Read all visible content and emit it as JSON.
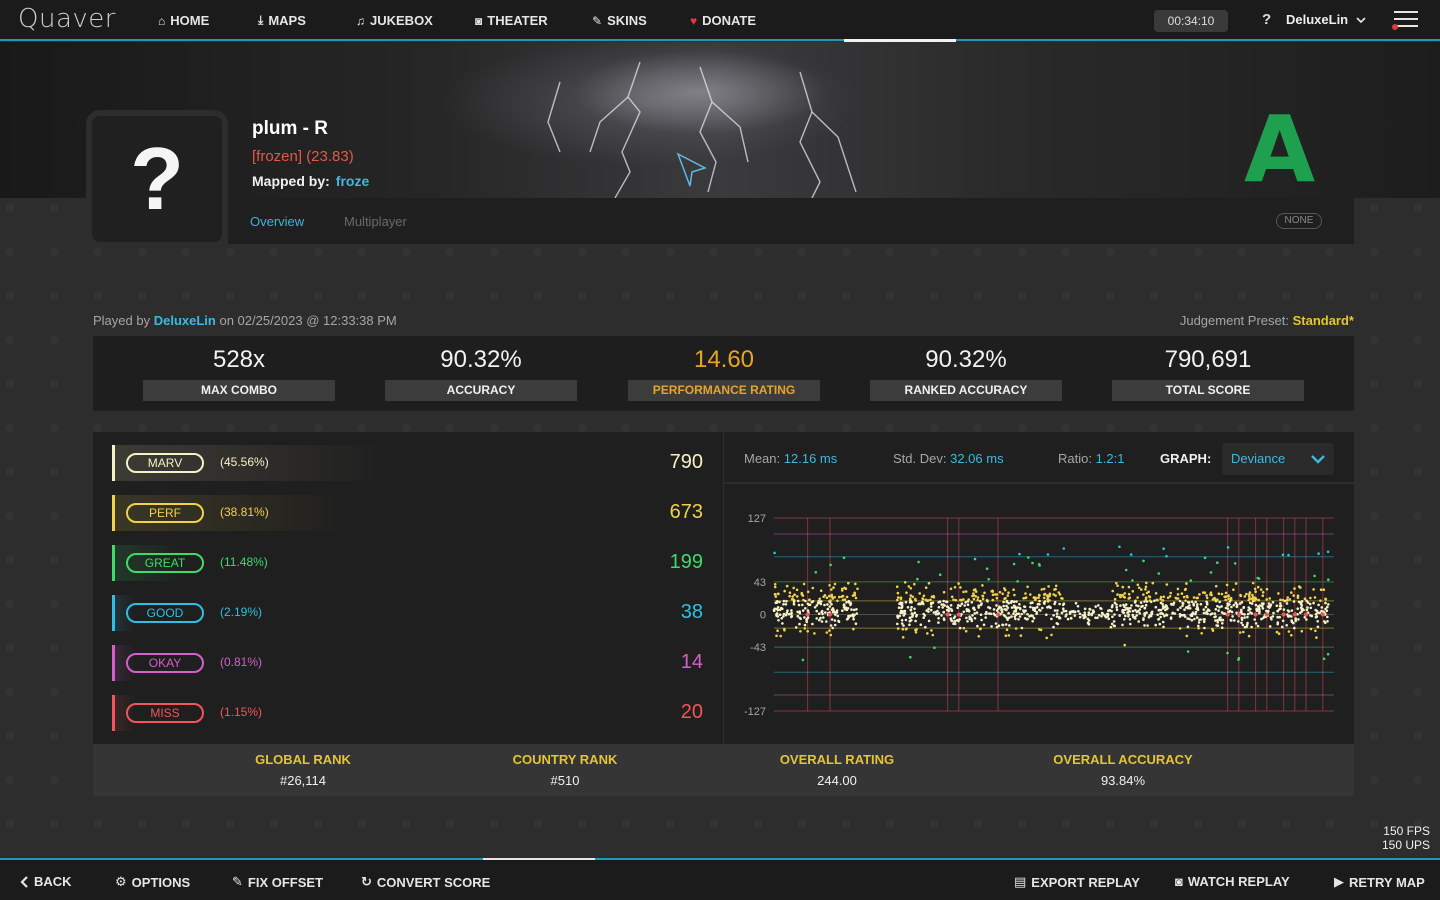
{
  "app": {
    "logo": "Quaver"
  },
  "nav": {
    "items": [
      {
        "label": "HOME",
        "icon": "home-icon",
        "glyph": "⌂"
      },
      {
        "label": "MAPS",
        "icon": "download-icon",
        "glyph": "⤓"
      },
      {
        "label": "JUKEBOX",
        "icon": "music-icon",
        "glyph": "♫"
      },
      {
        "label": "THEATER",
        "icon": "camera-icon",
        "glyph": "◙"
      },
      {
        "label": "SKINS",
        "icon": "pencil-icon",
        "glyph": "✎"
      },
      {
        "label": "DONATE",
        "icon": "heart-icon",
        "glyph": "♥"
      }
    ],
    "clock": "00:34:10",
    "help": "?",
    "username": "DeluxeLin"
  },
  "map": {
    "title": "plum - R",
    "difficulty": "[frozen] (23.83)",
    "mapped_by_label": "Mapped by:",
    "mapper": "froze",
    "cover_placeholder": "?",
    "grade": "A"
  },
  "tabs": {
    "overview": "Overview",
    "multiplayer": "Multiplayer",
    "mods": "NONE"
  },
  "play": {
    "played_by_label": "Played by",
    "player": "DeluxeLin",
    "date_text": "on 02/25/2023 @ 12:33:38 PM",
    "preset_label": "Judgement Preset:",
    "preset_value": "Standard*"
  },
  "stats": [
    {
      "value": "528x",
      "label": "MAX COMBO"
    },
    {
      "value": "90.32%",
      "label": "ACCURACY"
    },
    {
      "value": "14.60",
      "label": "PERFORMANCE RATING"
    },
    {
      "value": "90.32%",
      "label": "RANKED ACCURACY"
    },
    {
      "value": "790,691",
      "label": "TOTAL SCORE"
    }
  ],
  "judgements": [
    {
      "name": "MARV",
      "pct": "(45.56%)",
      "count": "790",
      "color": "#f7f1c8",
      "fill": 0.4556
    },
    {
      "name": "PERF",
      "pct": "(38.81%)",
      "count": "673",
      "color": "#f2d24a",
      "fill": 0.3881
    },
    {
      "name": "GREAT",
      "pct": "(11.48%)",
      "count": "199",
      "color": "#3ddc6a",
      "fill": 0.1148
    },
    {
      "name": "GOOD",
      "pct": "(2.19%)",
      "count": "38",
      "color": "#2fbfe4",
      "fill": 0.0219
    },
    {
      "name": "OKAY",
      "pct": "(0.81%)",
      "count": "14",
      "color": "#d55fcb",
      "fill": 0.0081
    },
    {
      "name": "MISS",
      "pct": "(1.15%)",
      "count": "20",
      "color": "#f2555a",
      "fill": 0.0115
    }
  ],
  "graph": {
    "mean_label": "Mean:",
    "mean": "12.16 ms",
    "std_label": "Std. Dev:",
    "std": "32.06 ms",
    "ratio_label": "Ratio:",
    "ratio": "1.2:1",
    "graph_label": "GRAPH:",
    "selected": "Deviance",
    "y_ticks": [
      "127",
      "43",
      "0",
      "-43",
      "-127"
    ]
  },
  "chart_data": {
    "type": "scatter",
    "title": "",
    "xlabel": "",
    "ylabel": "",
    "ylim": [
      -127,
      127
    ],
    "y_ticks": [
      127,
      43,
      0,
      -43,
      -127
    ],
    "judgement_lines": [
      {
        "value": 127,
        "color": "#f2555a"
      },
      {
        "value": 106,
        "color": "#d55fcb"
      },
      {
        "value": 76,
        "color": "#2fbfe4"
      },
      {
        "value": 43,
        "color": "#3ddc6a"
      },
      {
        "value": 18,
        "color": "#f2d24a"
      },
      {
        "value": 0,
        "color": "#8a8a8a"
      },
      {
        "value": -18,
        "color": "#f2d24a"
      },
      {
        "value": -43,
        "color": "#3ddc6a"
      },
      {
        "value": -76,
        "color": "#2fbfe4"
      },
      {
        "value": -106,
        "color": "#d55fcb"
      },
      {
        "value": -127,
        "color": "#f2555a"
      }
    ],
    "miss_x": [
      0.06,
      0.1,
      0.31,
      0.33,
      0.4,
      0.81,
      0.83,
      0.86,
      0.88,
      0.91,
      0.93,
      0.95,
      0.98
    ],
    "dense_ranges": [
      [
        0.0,
        0.15
      ],
      [
        0.22,
        0.52
      ],
      [
        0.6,
        0.99
      ]
    ],
    "sparse_range": [
      0.52,
      0.6
    ]
  },
  "footer_stats": [
    {
      "label": "GLOBAL RANK",
      "value": "#26,114"
    },
    {
      "label": "COUNTRY RANK",
      "value": "#510"
    },
    {
      "label": "OVERALL RATING",
      "value": "244.00"
    },
    {
      "label": "OVERALL ACCURACY",
      "value": "93.84%"
    }
  ],
  "fps": {
    "fps": "150 FPS",
    "ups": "150 UPS"
  },
  "bottom": {
    "back": "BACK",
    "options": "OPTIONS",
    "fix_offset": "FIX OFFSET",
    "convert": "CONVERT SCORE",
    "export": "EXPORT REPLAY",
    "watch": "WATCH REPLAY",
    "retry": "RETRY MAP"
  },
  "colors": {
    "accent": "#1e9bb4",
    "link": "#3fb8df",
    "gold": "#e6c52f",
    "grade": "#1fa04f"
  }
}
